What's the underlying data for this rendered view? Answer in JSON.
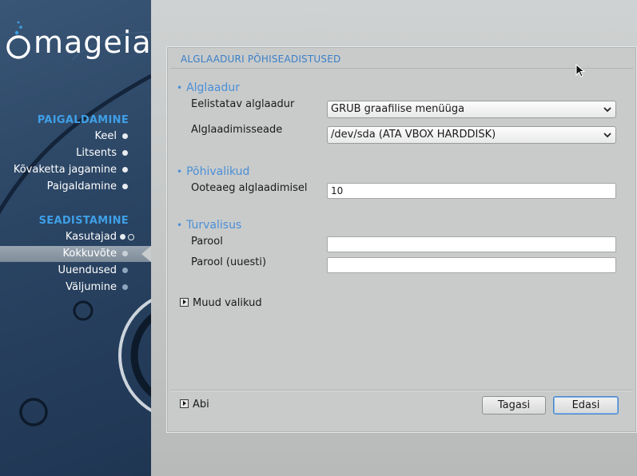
{
  "sidebar": {
    "logo_text": "mageia",
    "sections": [
      {
        "heading": "PAIGALDAMINE",
        "items": [
          {
            "label": "Keel",
            "state": "done"
          },
          {
            "label": "Litsents",
            "state": "done"
          },
          {
            "label": "Kõvaketta jagamine",
            "state": "done"
          },
          {
            "label": "Paigaldamine",
            "state": "done"
          }
        ]
      },
      {
        "heading": "SEADISTAMINE",
        "items": [
          {
            "label": "Kasutajad",
            "state": "done"
          },
          {
            "label": "Kokkuvõte",
            "state": "current"
          },
          {
            "label": "Uuendused",
            "state": "todo"
          },
          {
            "label": "Väljumine",
            "state": "todo"
          }
        ]
      }
    ]
  },
  "panel": {
    "title": "ALGLAADURI PÕHISEADISTUSED",
    "sections": {
      "bootloader": {
        "heading": "Alglaadur",
        "preferred_label": "Eelistatav alglaadur",
        "preferred_value": "GRUB graafilise menüüga",
        "device_label": "Alglaadimisseade",
        "device_value": "/dev/sda (ATA VBOX HARDDISK)"
      },
      "main_options": {
        "heading": "Põhivalikud",
        "timeout_label": "Ooteaeg alglaadimisel",
        "timeout_value": "10"
      },
      "security": {
        "heading": "Turvalisus",
        "password_label": "Parool",
        "password_value": "",
        "password_again_label": "Parool (uuesti)",
        "password_again_value": ""
      }
    },
    "more_options_label": "Muud valikud",
    "help_label": "Abi",
    "back_button": "Tagasi",
    "next_button": "Edasi"
  },
  "colors": {
    "sidebar_bg": "#2a4463",
    "sidebar_heading": "#3f9fe6",
    "section_heading": "#4b8fd6",
    "panel_title": "#3a7fc7"
  }
}
